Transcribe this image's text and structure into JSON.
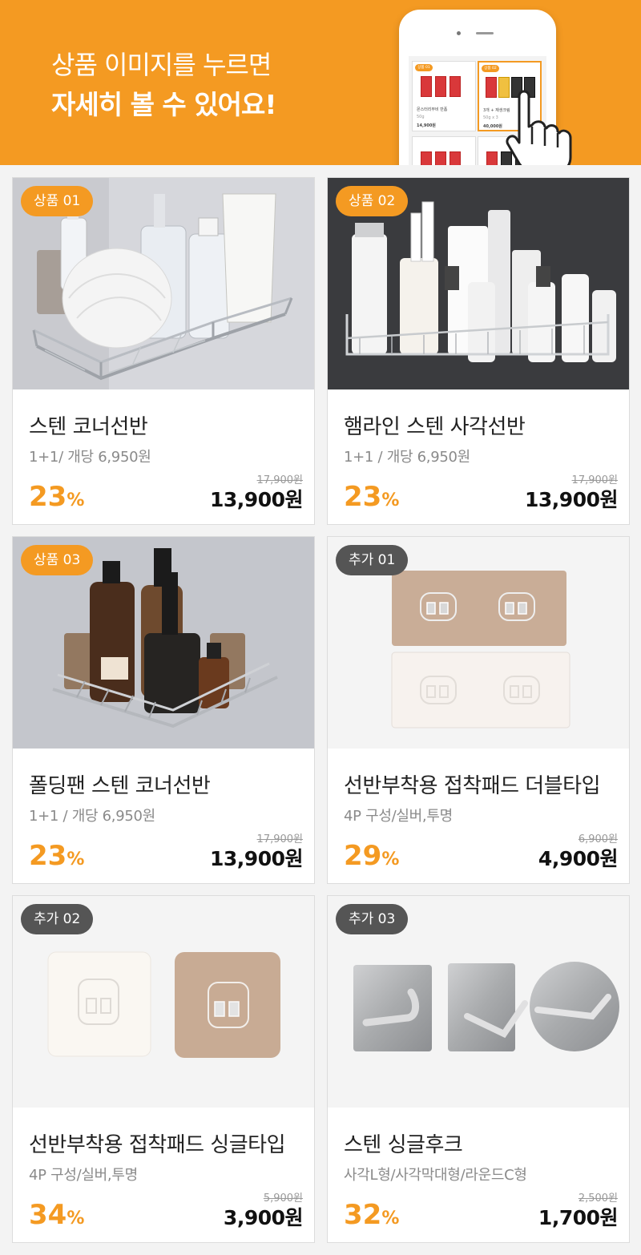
{
  "banner": {
    "line1": "상품 이미지를 누르면",
    "line2": "자세히 볼 수 있어요!",
    "phone_preview": {
      "card1": {
        "badge": "상품 01",
        "name": "몬스터리무비 반폼",
        "size": "50g",
        "price": "14,900원"
      },
      "card2": {
        "badge": "상품 02",
        "name": "3개 + 재생크림",
        "size": "50g x 3",
        "price": "40,000원"
      }
    }
  },
  "colors": {
    "accent": "#f49a22",
    "badge_gray": "#555555",
    "banner_bg": "#f49a22"
  },
  "products": [
    {
      "badge": "상품 01",
      "badge_style": "orange",
      "title": "스텐 코너선반",
      "subtitle": "1+1/ 개당 6,950원",
      "discount": "23",
      "discount_unit": "%",
      "original_price": "17,900원",
      "price": "13,900원",
      "image": "corner-shelf-toiletries"
    },
    {
      "badge": "상품 02",
      "badge_style": "orange",
      "title": "햄라인 스텐 사각선반",
      "subtitle": "1+1 / 개당 6,950원",
      "discount": "23",
      "discount_unit": "%",
      "original_price": "17,900원",
      "price": "13,900원",
      "image": "square-shelf-cosmetics"
    },
    {
      "badge": "상품 03",
      "badge_style": "orange",
      "title": "폴딩팬 스텐 코너선반",
      "subtitle": "1+1 / 개당 6,950원",
      "discount": "23",
      "discount_unit": "%",
      "original_price": "17,900원",
      "price": "13,900원",
      "image": "folding-corner-shelf-bottles"
    },
    {
      "badge": "추가 01",
      "badge_style": "gray",
      "title": "선반부착용 접착패드 더블타입",
      "subtitle": "4P 구성/실버,투명",
      "discount": "29",
      "discount_unit": "%",
      "original_price": "6,900원",
      "price": "4,900원",
      "image": "adhesive-pad-double"
    },
    {
      "badge": "추가 02",
      "badge_style": "gray",
      "title": "선반부착용 접착패드 싱글타입",
      "subtitle": "4P 구성/실버,투명",
      "discount": "34",
      "discount_unit": "%",
      "original_price": "5,900원",
      "price": "3,900원",
      "image": "adhesive-pad-single"
    },
    {
      "badge": "추가 03",
      "badge_style": "gray",
      "title": "스텐 싱글후크",
      "subtitle": "사각L형/사각막대형/라운드C형",
      "discount": "32",
      "discount_unit": "%",
      "original_price": "2,500원",
      "price": "1,700원",
      "image": "steel-single-hooks"
    }
  ]
}
